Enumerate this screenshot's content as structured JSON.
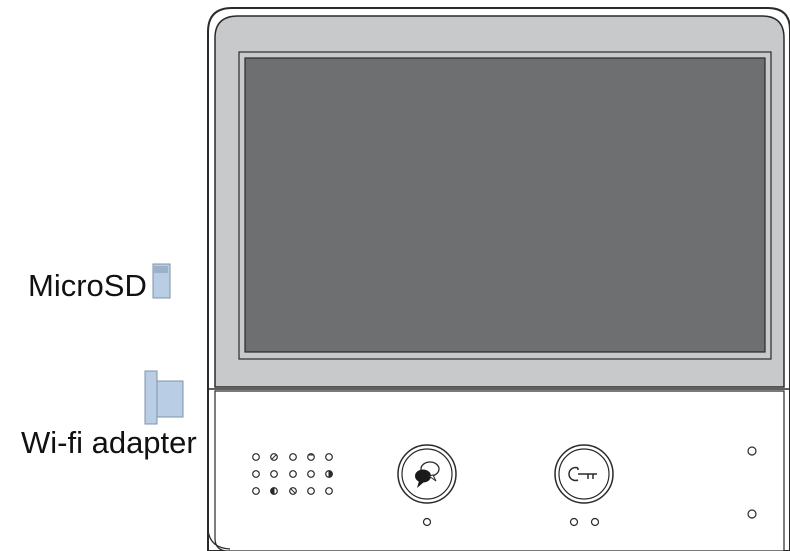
{
  "labels": {
    "microsd": "MicroSD",
    "wifi_adapter": "Wi-fi adapter"
  },
  "icons": {
    "talk_button": "speech-bubble-icon",
    "unlock_button": "key-icon"
  },
  "colors": {
    "bezel": "#c8c9cb",
    "screen": "#6e6f70",
    "outline": "#2a2a2a",
    "accessory_fill": "#b9cde4"
  }
}
